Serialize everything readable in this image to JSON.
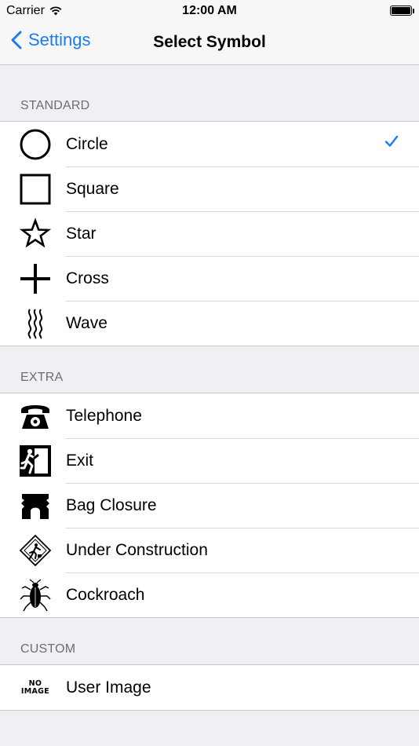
{
  "status_bar": {
    "carrier": "Carrier",
    "time": "12:00 AM"
  },
  "nav": {
    "back_label": "Settings",
    "title": "Select Symbol"
  },
  "sections": {
    "standard": {
      "header": "STANDARD",
      "items": [
        {
          "label": "Circle",
          "icon": "circle-icon",
          "selected": true
        },
        {
          "label": "Square",
          "icon": "square-icon"
        },
        {
          "label": "Star",
          "icon": "star-icon"
        },
        {
          "label": "Cross",
          "icon": "cross-icon"
        },
        {
          "label": "Wave",
          "icon": "wave-icon"
        }
      ]
    },
    "extra": {
      "header": "EXTRA",
      "items": [
        {
          "label": "Telephone",
          "icon": "telephone-icon"
        },
        {
          "label": "Exit",
          "icon": "exit-icon"
        },
        {
          "label": "Bag Closure",
          "icon": "bag-closure-icon"
        },
        {
          "label": "Under Construction",
          "icon": "under-construction-icon"
        },
        {
          "label": "Cockroach",
          "icon": "cockroach-icon"
        }
      ]
    },
    "custom": {
      "header": "CUSTOM",
      "items": [
        {
          "label": "User Image",
          "icon": "no-image-icon",
          "icon_text_top": "NO",
          "icon_text_bottom": "IMAGE"
        }
      ]
    }
  },
  "colors": {
    "accent": "#1a7cf6",
    "background": "#efeff4",
    "header_text": "#6d6d72"
  }
}
